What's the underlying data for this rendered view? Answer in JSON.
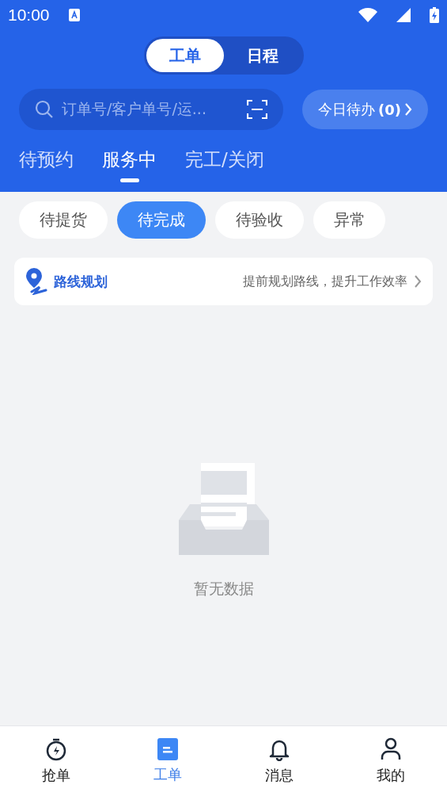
{
  "status_bar": {
    "time": "10:00"
  },
  "mode_switch": [
    {
      "label": "工单",
      "selected": true
    },
    {
      "label": "日程",
      "selected": false
    }
  ],
  "search": {
    "placeholder": "订单号/客户单号/运..."
  },
  "today_todo": {
    "label": "今日待办",
    "count": "(0)"
  },
  "tabs": [
    {
      "label": "待预约",
      "selected": false
    },
    {
      "label": "服务中",
      "selected": true
    },
    {
      "label": "完工/关闭",
      "selected": false
    }
  ],
  "filters": [
    {
      "label": "待提货",
      "selected": false
    },
    {
      "label": "待完成",
      "selected": true
    },
    {
      "label": "待验收",
      "selected": false
    },
    {
      "label": "异常",
      "selected": false
    }
  ],
  "route_banner": {
    "title": "路线规划",
    "hint": "提前规划路线，提升工作效率"
  },
  "empty_state": {
    "text": "暂无数据"
  },
  "bottom_nav": [
    {
      "kind": "grab",
      "label": "抢单",
      "selected": false
    },
    {
      "kind": "orders",
      "label": "工单",
      "selected": true
    },
    {
      "kind": "messages",
      "label": "消息",
      "selected": false
    },
    {
      "kind": "profile",
      "label": "我的",
      "selected": false
    }
  ]
}
